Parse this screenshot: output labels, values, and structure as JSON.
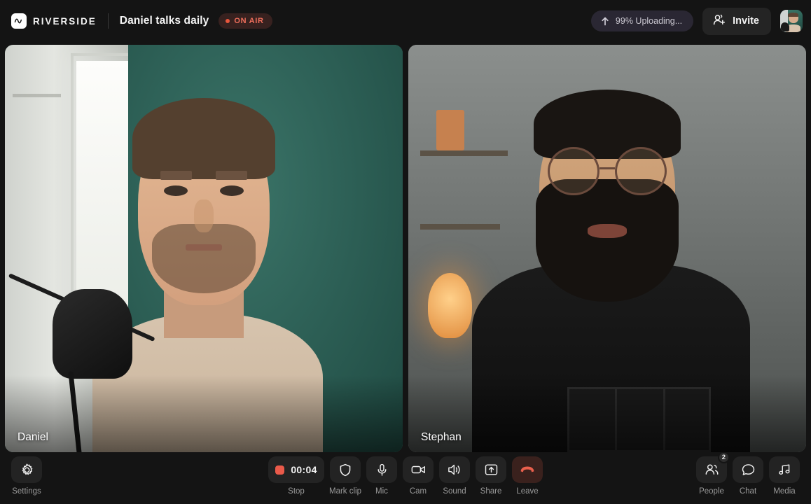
{
  "header": {
    "brand_name": "RIVERSIDE",
    "logo_icon": "riverside-wave-icon",
    "session_title": "Daniel talks daily",
    "on_air_label": "ON AIR",
    "on_air_color": "#ef6f5c",
    "upload_status": "99% Uploading...",
    "upload_icon": "upload-arrow-icon",
    "invite_label": "Invite",
    "invite_icon": "add-person-icon",
    "avatar_name": "Daniel"
  },
  "stage": {
    "participants": [
      {
        "name": "Daniel",
        "position": "left"
      },
      {
        "name": "Stephan",
        "position": "right"
      }
    ]
  },
  "toolbar": {
    "left": [
      {
        "label": "Settings",
        "icon": "gear-icon"
      }
    ],
    "center": [
      {
        "label": "Stop",
        "icon": "record-stop-icon",
        "value": "00:04"
      },
      {
        "label": "Mark clip",
        "icon": "shield-bookmark-icon"
      },
      {
        "label": "Mic",
        "icon": "microphone-icon"
      },
      {
        "label": "Cam",
        "icon": "camera-icon"
      },
      {
        "label": "Sound",
        "icon": "speaker-icon"
      },
      {
        "label": "Share",
        "icon": "share-screen-icon"
      },
      {
        "label": "Leave",
        "icon": "phone-hangup-icon"
      }
    ],
    "right": [
      {
        "label": "People",
        "icon": "people-icon",
        "badge": "2"
      },
      {
        "label": "Chat",
        "icon": "chat-bubble-icon"
      },
      {
        "label": "Media",
        "icon": "music-note-icon"
      }
    ]
  },
  "colors": {
    "background": "#141414",
    "surface": "#232323",
    "accent_record": "#ea5a4a",
    "accent_leave_bg": "#3a211d",
    "text_primary": "#f2f2f2",
    "text_muted": "#9a9a9a"
  }
}
